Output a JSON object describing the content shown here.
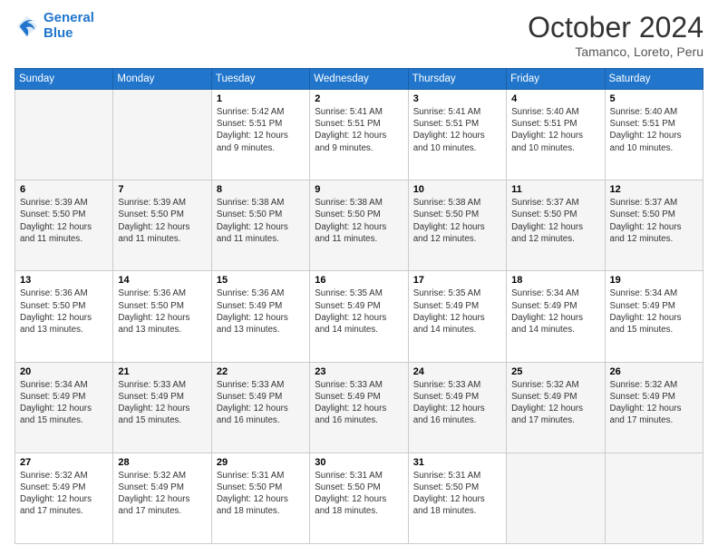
{
  "logo": {
    "line1": "General",
    "line2": "Blue"
  },
  "title": "October 2024",
  "location": "Tamanco, Loreto, Peru",
  "days_of_week": [
    "Sunday",
    "Monday",
    "Tuesday",
    "Wednesday",
    "Thursday",
    "Friday",
    "Saturday"
  ],
  "weeks": [
    [
      {
        "num": "",
        "info": ""
      },
      {
        "num": "",
        "info": ""
      },
      {
        "num": "1",
        "info": "Sunrise: 5:42 AM\nSunset: 5:51 PM\nDaylight: 12 hours and 9 minutes."
      },
      {
        "num": "2",
        "info": "Sunrise: 5:41 AM\nSunset: 5:51 PM\nDaylight: 12 hours and 9 minutes."
      },
      {
        "num": "3",
        "info": "Sunrise: 5:41 AM\nSunset: 5:51 PM\nDaylight: 12 hours and 10 minutes."
      },
      {
        "num": "4",
        "info": "Sunrise: 5:40 AM\nSunset: 5:51 PM\nDaylight: 12 hours and 10 minutes."
      },
      {
        "num": "5",
        "info": "Sunrise: 5:40 AM\nSunset: 5:51 PM\nDaylight: 12 hours and 10 minutes."
      }
    ],
    [
      {
        "num": "6",
        "info": "Sunrise: 5:39 AM\nSunset: 5:50 PM\nDaylight: 12 hours and 11 minutes."
      },
      {
        "num": "7",
        "info": "Sunrise: 5:39 AM\nSunset: 5:50 PM\nDaylight: 12 hours and 11 minutes."
      },
      {
        "num": "8",
        "info": "Sunrise: 5:38 AM\nSunset: 5:50 PM\nDaylight: 12 hours and 11 minutes."
      },
      {
        "num": "9",
        "info": "Sunrise: 5:38 AM\nSunset: 5:50 PM\nDaylight: 12 hours and 11 minutes."
      },
      {
        "num": "10",
        "info": "Sunrise: 5:38 AM\nSunset: 5:50 PM\nDaylight: 12 hours and 12 minutes."
      },
      {
        "num": "11",
        "info": "Sunrise: 5:37 AM\nSunset: 5:50 PM\nDaylight: 12 hours and 12 minutes."
      },
      {
        "num": "12",
        "info": "Sunrise: 5:37 AM\nSunset: 5:50 PM\nDaylight: 12 hours and 12 minutes."
      }
    ],
    [
      {
        "num": "13",
        "info": "Sunrise: 5:36 AM\nSunset: 5:50 PM\nDaylight: 12 hours and 13 minutes."
      },
      {
        "num": "14",
        "info": "Sunrise: 5:36 AM\nSunset: 5:50 PM\nDaylight: 12 hours and 13 minutes."
      },
      {
        "num": "15",
        "info": "Sunrise: 5:36 AM\nSunset: 5:49 PM\nDaylight: 12 hours and 13 minutes."
      },
      {
        "num": "16",
        "info": "Sunrise: 5:35 AM\nSunset: 5:49 PM\nDaylight: 12 hours and 14 minutes."
      },
      {
        "num": "17",
        "info": "Sunrise: 5:35 AM\nSunset: 5:49 PM\nDaylight: 12 hours and 14 minutes."
      },
      {
        "num": "18",
        "info": "Sunrise: 5:34 AM\nSunset: 5:49 PM\nDaylight: 12 hours and 14 minutes."
      },
      {
        "num": "19",
        "info": "Sunrise: 5:34 AM\nSunset: 5:49 PM\nDaylight: 12 hours and 15 minutes."
      }
    ],
    [
      {
        "num": "20",
        "info": "Sunrise: 5:34 AM\nSunset: 5:49 PM\nDaylight: 12 hours and 15 minutes."
      },
      {
        "num": "21",
        "info": "Sunrise: 5:33 AM\nSunset: 5:49 PM\nDaylight: 12 hours and 15 minutes."
      },
      {
        "num": "22",
        "info": "Sunrise: 5:33 AM\nSunset: 5:49 PM\nDaylight: 12 hours and 16 minutes."
      },
      {
        "num": "23",
        "info": "Sunrise: 5:33 AM\nSunset: 5:49 PM\nDaylight: 12 hours and 16 minutes."
      },
      {
        "num": "24",
        "info": "Sunrise: 5:33 AM\nSunset: 5:49 PM\nDaylight: 12 hours and 16 minutes."
      },
      {
        "num": "25",
        "info": "Sunrise: 5:32 AM\nSunset: 5:49 PM\nDaylight: 12 hours and 17 minutes."
      },
      {
        "num": "26",
        "info": "Sunrise: 5:32 AM\nSunset: 5:49 PM\nDaylight: 12 hours and 17 minutes."
      }
    ],
    [
      {
        "num": "27",
        "info": "Sunrise: 5:32 AM\nSunset: 5:49 PM\nDaylight: 12 hours and 17 minutes."
      },
      {
        "num": "28",
        "info": "Sunrise: 5:32 AM\nSunset: 5:49 PM\nDaylight: 12 hours and 17 minutes."
      },
      {
        "num": "29",
        "info": "Sunrise: 5:31 AM\nSunset: 5:50 PM\nDaylight: 12 hours and 18 minutes."
      },
      {
        "num": "30",
        "info": "Sunrise: 5:31 AM\nSunset: 5:50 PM\nDaylight: 12 hours and 18 minutes."
      },
      {
        "num": "31",
        "info": "Sunrise: 5:31 AM\nSunset: 5:50 PM\nDaylight: 12 hours and 18 minutes."
      },
      {
        "num": "",
        "info": ""
      },
      {
        "num": "",
        "info": ""
      }
    ]
  ]
}
